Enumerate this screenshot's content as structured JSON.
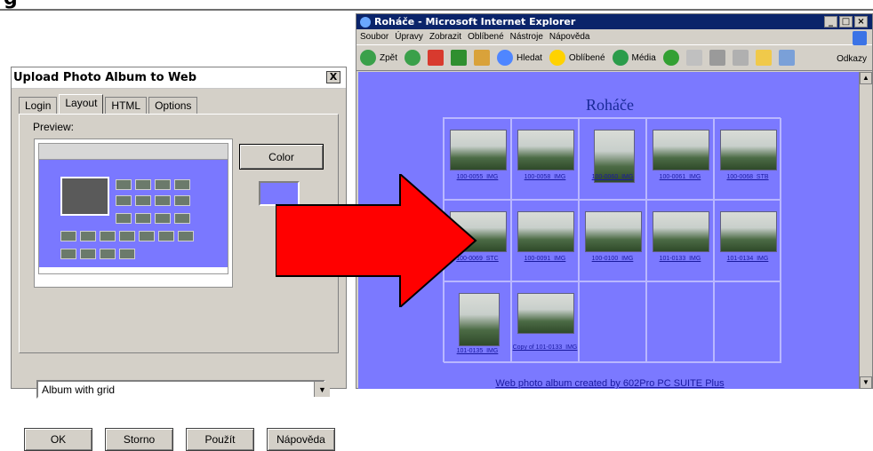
{
  "dialog": {
    "title": "Upload Photo Album to Web",
    "close": "X",
    "tabs": [
      "Login",
      "Layout",
      "HTML",
      "Options"
    ],
    "preview_label": "Preview:",
    "color_button": "Color",
    "swatch_color": "#7b79ff",
    "template_value": "Album with grid",
    "buttons": [
      "OK",
      "Storno",
      "Použít",
      "Nápověda"
    ]
  },
  "ie": {
    "window_title": "Roháče - Microsoft Internet Explorer",
    "menu": [
      "Soubor",
      "Úpravy",
      "Zobrazit",
      "Oblíbené",
      "Nástroje",
      "Nápověda"
    ],
    "toolbar": {
      "back": "Zpět",
      "search": "Hledat",
      "favorites": "Oblíbené",
      "media": "Média",
      "links": "Odkazy"
    },
    "album_title": "Roháče",
    "captions": [
      "100-0055_IMG",
      "100-0058_IMG",
      "100-0060_IMG",
      "100-0061_IMG",
      "100-0068_STB",
      "100-0069_STC",
      "100-0091_IMG",
      "100-0100_IMG",
      "101-0133_IMG",
      "101-0134_IMG",
      "101-0135_IMG",
      "Copy of 101-0133_IMG"
    ],
    "footer": "Web photo album created by 602Pro PC SUITE Plus",
    "page_bg": "#7b79ff"
  },
  "arrow_color": "#ff0000"
}
